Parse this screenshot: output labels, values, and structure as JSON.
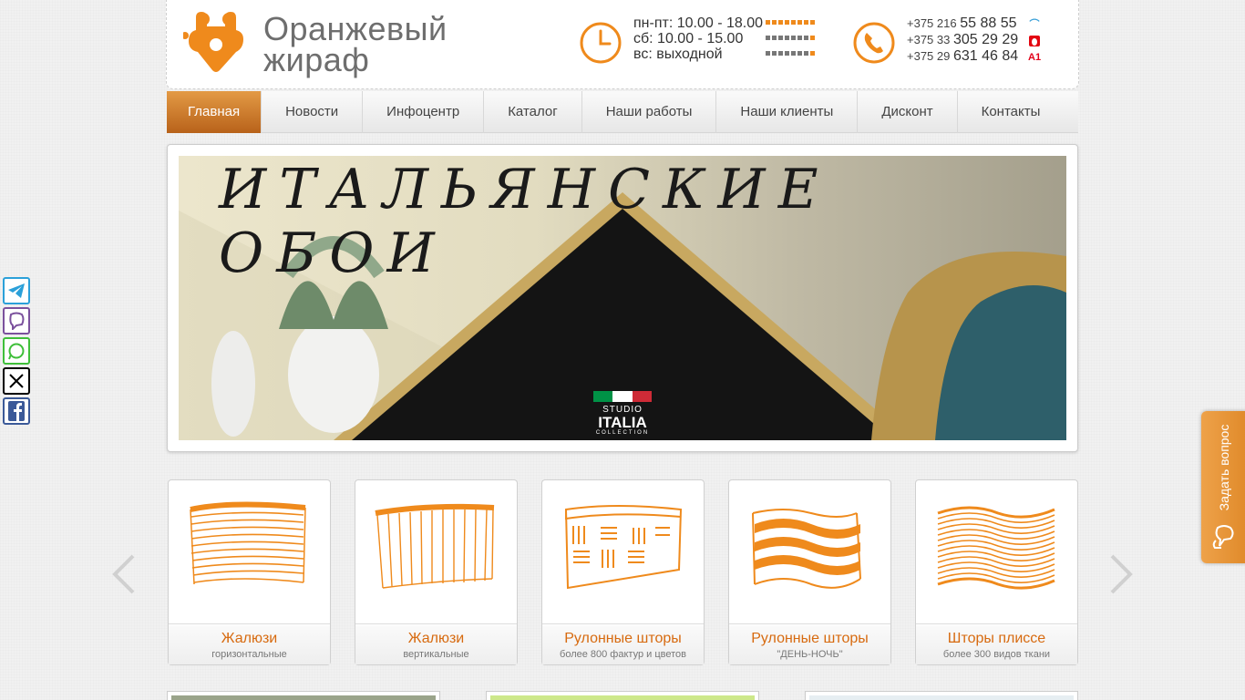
{
  "header": {
    "logo_line1": "Оранжевый",
    "logo_line2": "жираф",
    "hours": [
      "пн-пт: 10.00 - 18.00",
      "сб: 10.00 - 15.00",
      "вс: выходной"
    ],
    "phones": [
      {
        "prefix": "+375 216",
        "number": "55 88 55",
        "operator": "velcom-icon"
      },
      {
        "prefix": "+375 33",
        "number": "305 29 29",
        "operator": "mts-icon"
      },
      {
        "prefix": "+375 29",
        "number": "631 46 84",
        "operator": "a1-icon"
      }
    ]
  },
  "nav": {
    "items": [
      "Главная",
      "Новости",
      "Инфоцентр",
      "Каталог",
      "Наши работы",
      "Наши клиенты",
      "Дисконт",
      "Контакты"
    ],
    "active": "Главная"
  },
  "banner": {
    "title": "ИТАЛЬЯНСКИЕ ОБОИ",
    "brand_line1": "STUDIO",
    "brand_line2": "ITALIA",
    "brand_line3": "COLLECTION"
  },
  "social": [
    "telegram-icon",
    "viber-icon",
    "whatsapp-icon",
    "x-icon",
    "facebook-icon"
  ],
  "products": [
    {
      "title": "Жалюзи",
      "subtitle": "горизонтальные"
    },
    {
      "title": "Жалюзи",
      "subtitle": "вертикальные"
    },
    {
      "title": "Рулонные шторы",
      "subtitle": "более 800 фактур и цветов"
    },
    {
      "title": "Рулонные шторы",
      "subtitle": "\"ДЕНЬ-НОЧЬ\""
    },
    {
      "title": "Шторы плиссе",
      "subtitle": "более 300 видов ткани"
    }
  ],
  "ask": {
    "label": "Задать вопрос"
  },
  "colors": {
    "accent": "#ef8a1c",
    "nav_active": "#c8701f",
    "product_title": "#d76a0f"
  }
}
